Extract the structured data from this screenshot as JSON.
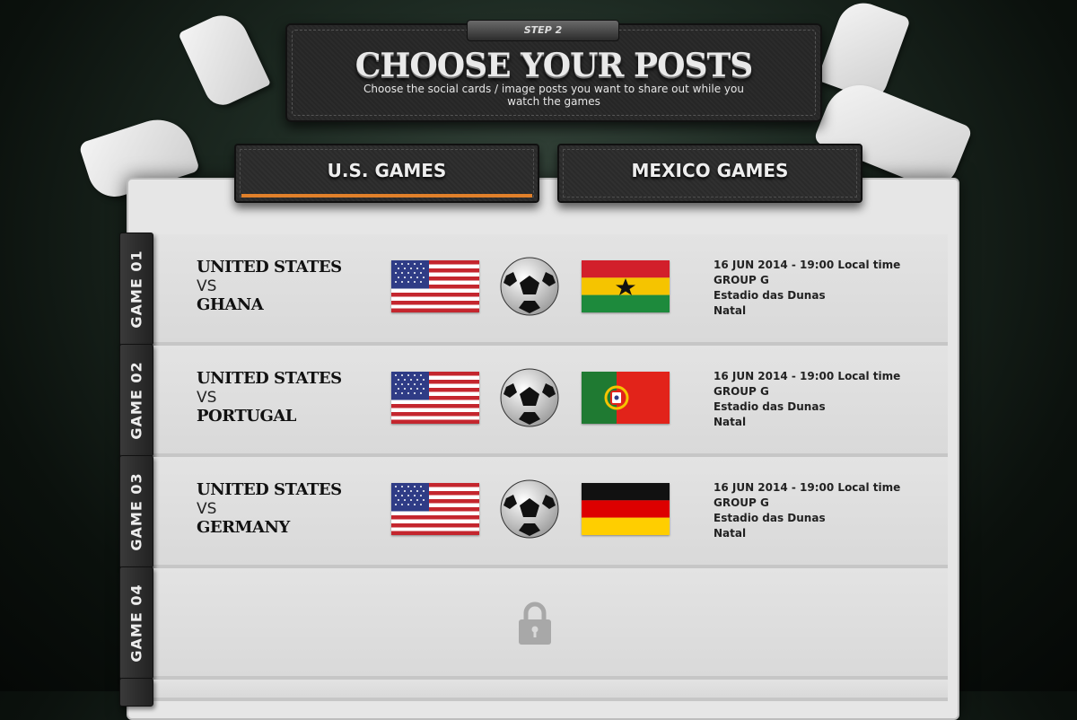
{
  "header": {
    "step": "STEP 2",
    "title": "CHOOSE YOUR POSTS",
    "subtitle": "Choose the social cards / image posts you want to share out while you watch the games"
  },
  "tabs": [
    {
      "label": "U.S. GAMES",
      "active": true
    },
    {
      "label": "MEXICO GAMES",
      "active": false
    }
  ],
  "colors": {
    "accent": "#e0802a"
  },
  "games": [
    {
      "tab": "GAME 01",
      "team1": "UNITED STATES",
      "vs": "VS",
      "team2": "GHANA",
      "date": "16 JUN 2014 - 19:00 Local time",
      "group": "GROUP G",
      "stadium": "Estadio das Dunas",
      "city": "Natal",
      "flag1": "usa-flag",
      "flag2": "ghana-flag"
    },
    {
      "tab": "GAME 02",
      "team1": "UNITED STATES",
      "vs": "VS",
      "team2": "PORTUGAL",
      "date": "16 JUN 2014 - 19:00 Local time",
      "group": "GROUP G",
      "stadium": "Estadio das Dunas",
      "city": "Natal",
      "flag1": "usa-flag",
      "flag2": "portugal-flag"
    },
    {
      "tab": "GAME 03",
      "team1": "UNITED STATES",
      "vs": "VS",
      "team2": "GERMANY",
      "date": "16 JUN 2014 - 19:00 Local time",
      "group": "GROUP G",
      "stadium": "Estadio das Dunas",
      "city": "Natal",
      "flag1": "usa-flag",
      "flag2": "germany-flag"
    },
    {
      "tab": "GAME 04",
      "locked": true,
      "icon": "lock-icon"
    }
  ]
}
